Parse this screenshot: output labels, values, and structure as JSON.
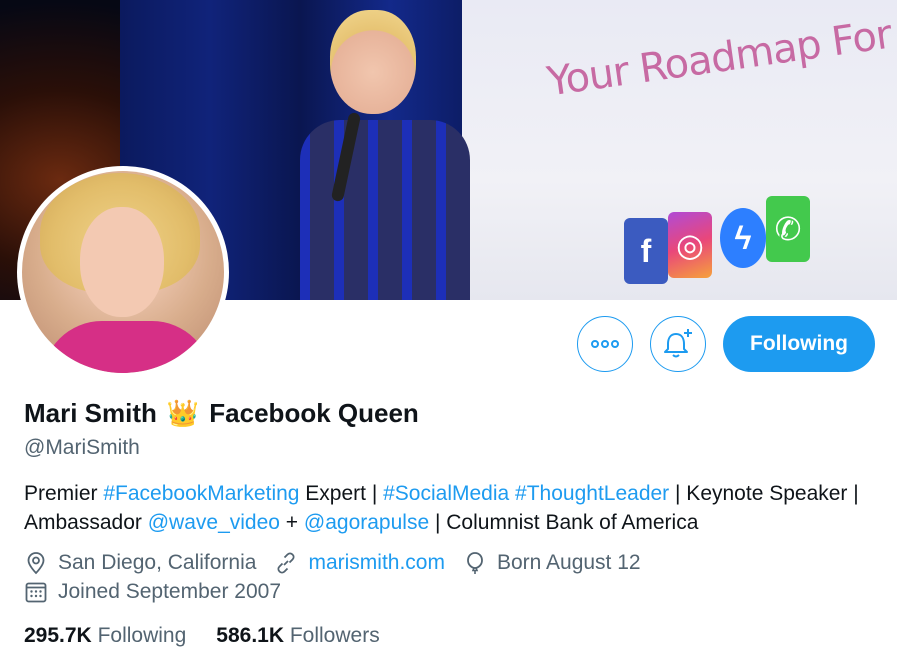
{
  "banner": {
    "screen_text": "Your Roadmap For The Futur",
    "icons": [
      "facebook-icon",
      "instagram-icon",
      "messenger-icon",
      "whatsapp-icon"
    ]
  },
  "actions": {
    "more_label": "More",
    "notify_label": "Turn on notifications",
    "following_label": "Following"
  },
  "profile": {
    "name_first": "Mari Smith",
    "name_emoji": "👑",
    "name_second": "Facebook Queen",
    "handle": "@MariSmith"
  },
  "bio": {
    "t1": "Premier ",
    "h1": "#FacebookMarketing",
    "t2": " Expert | ",
    "h2": "#SocialMedia",
    "t3": " ",
    "h3": "#ThoughtLeader",
    "t4": " | Keynote Speaker | Ambassador ",
    "m1": "@wave_video",
    "t5": " + ",
    "m2": "@agorapulse",
    "t6": " | Columnist Bank of America"
  },
  "meta": {
    "location": "San Diego, California",
    "website": "marismith.com",
    "birthday": "Born August 12",
    "joined": "Joined September 2007"
  },
  "stats": {
    "following_count": "295.7K",
    "following_label": "Following",
    "followers_count": "586.1K",
    "followers_label": "Followers"
  },
  "colors": {
    "accent": "#1d9bf0",
    "secondary_text": "#536471",
    "primary_text": "#0f1419"
  }
}
